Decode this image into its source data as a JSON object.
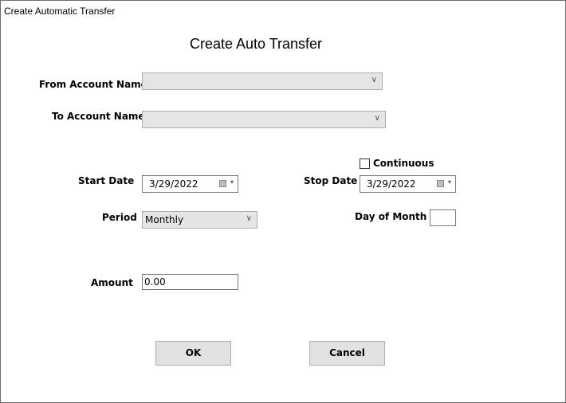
{
  "window": {
    "title": "Create Automatic Transfer"
  },
  "heading": "Create Auto Transfer",
  "form": {
    "from_account": {
      "label": "From Account Name",
      "value": "",
      "arrow": "∨"
    },
    "to_account": {
      "label": "To Account Name",
      "value": "",
      "arrow": "∨"
    },
    "continuous": {
      "label": "Continuous",
      "checked": false
    },
    "start_date": {
      "label": "Start Date",
      "value": "3/29/2022",
      "dropdown": "▾"
    },
    "stop_date": {
      "label": "Stop Date",
      "value": "3/29/2022",
      "dropdown": "▾"
    },
    "period": {
      "label": "Period",
      "value": "Monthly",
      "arrow": "∨"
    },
    "day_of_month": {
      "label": "Day of Month",
      "value": ""
    },
    "amount": {
      "label": "Amount",
      "value": "0.00"
    }
  },
  "buttons": {
    "ok": "OK",
    "cancel": "Cancel"
  }
}
